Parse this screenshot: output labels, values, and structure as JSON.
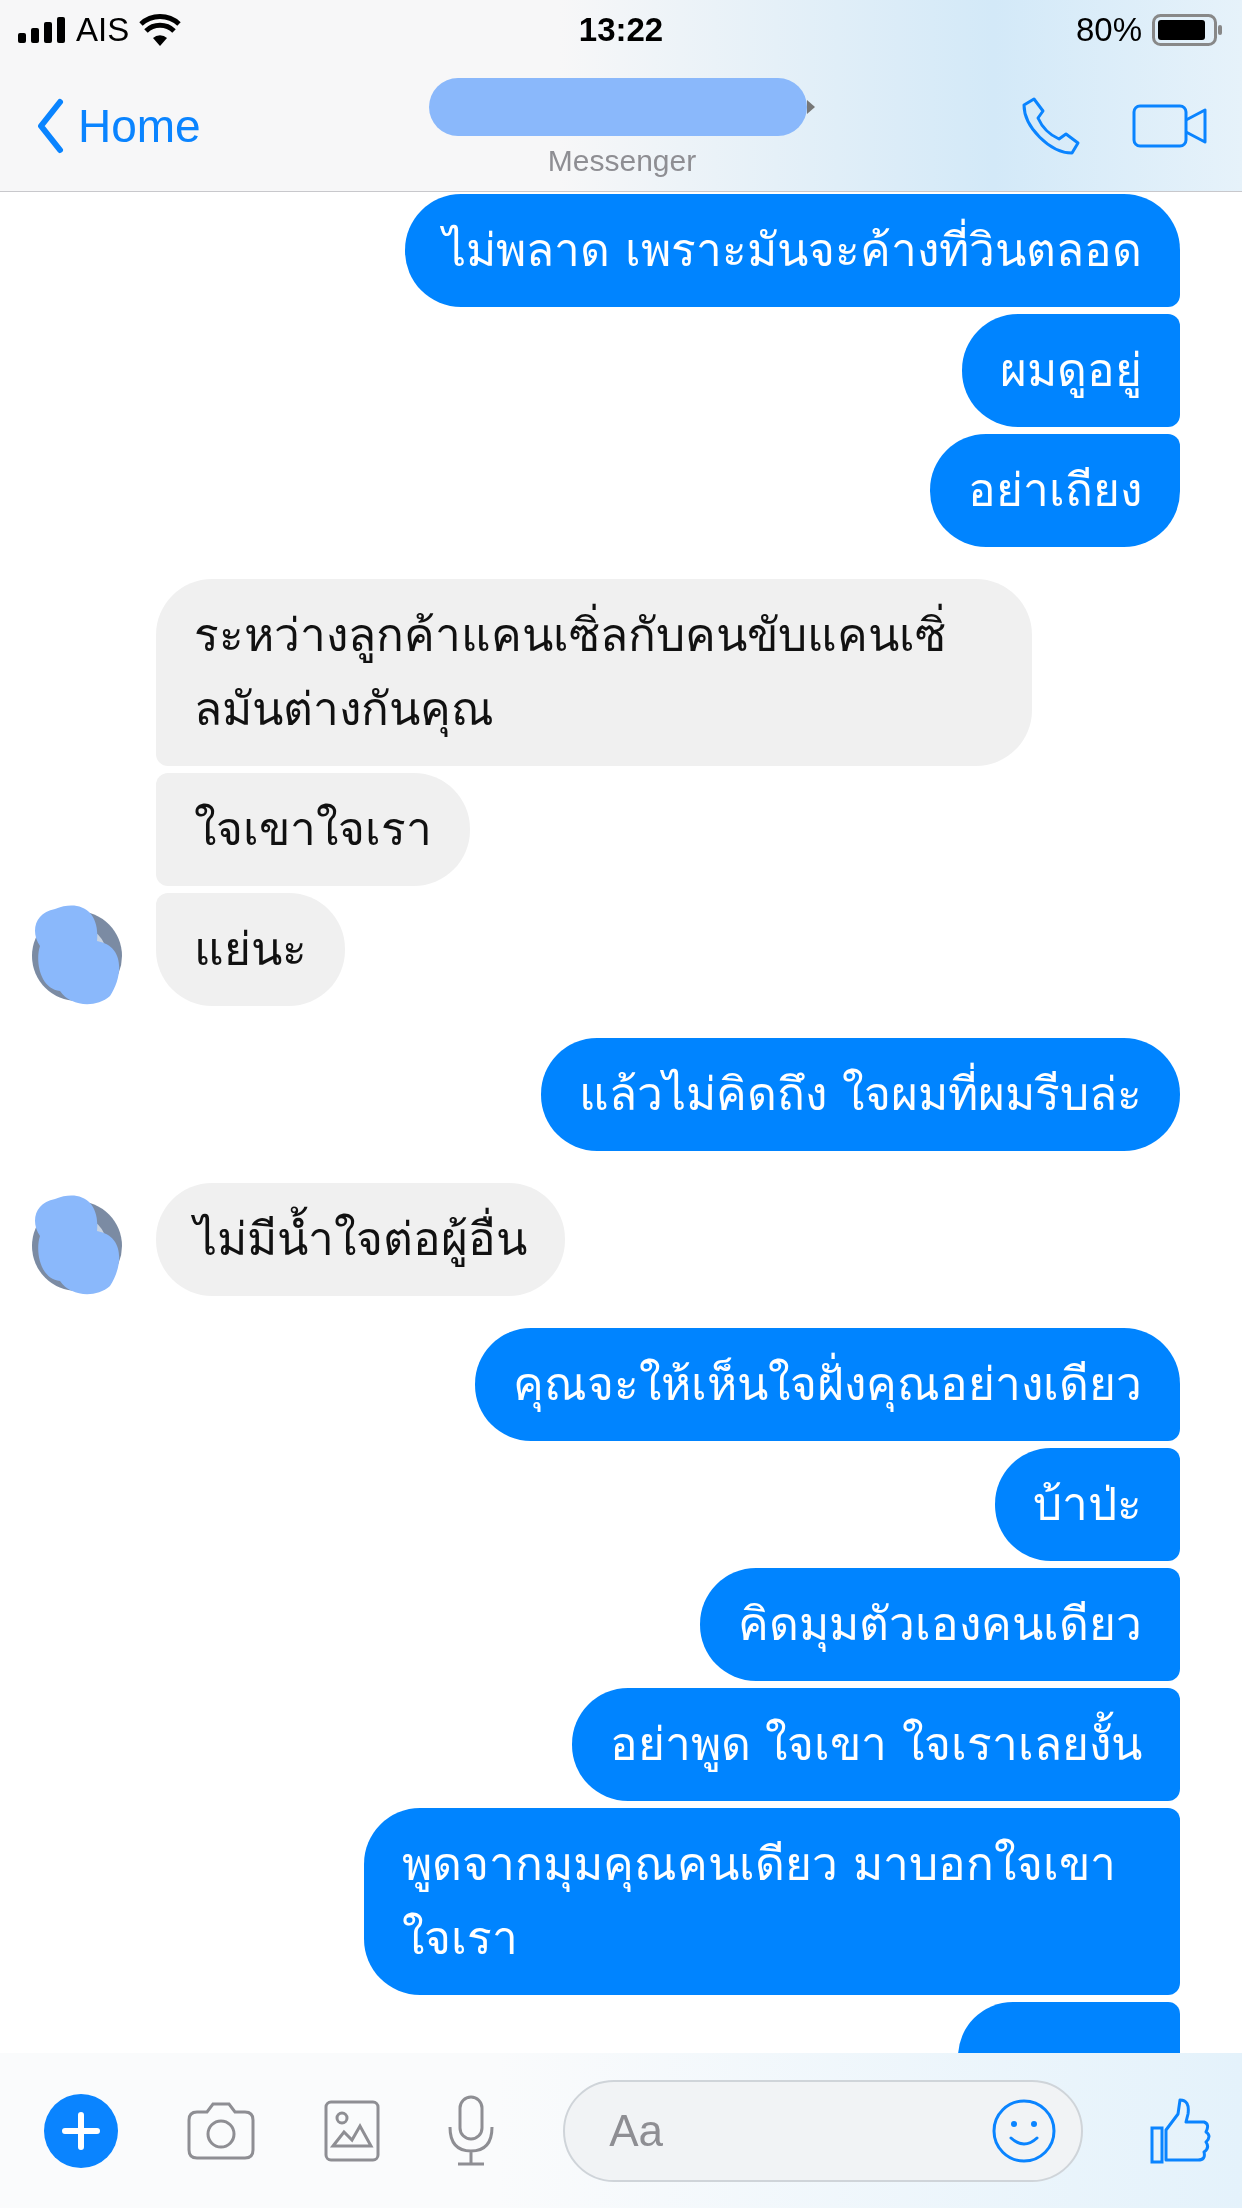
{
  "status_bar": {
    "carrier": "AIS",
    "time": "13:22",
    "battery": "80%"
  },
  "nav": {
    "back_label": "Home",
    "subtitle": "Messenger"
  },
  "groups": [
    {
      "kind": "sent",
      "bubbles": [
        {
          "text": "ไม่พลาด เพราะมันจะค้างที่วินตลอด"
        },
        {
          "text": "ผมดูอยู่"
        },
        {
          "text": "อย่าเถียง"
        }
      ]
    },
    {
      "kind": "received",
      "bubbles": [
        {
          "text": "ระหว่างลูกค้าแคนเซิ่ลกับคนขับแคนเซิ่ลมันต่างกันคุณ"
        },
        {
          "text": "ใจเขาใจเรา"
        },
        {
          "text": "แย่นะ"
        }
      ]
    },
    {
      "kind": "sent",
      "bubbles": [
        {
          "text": "แล้วไม่คิดถึง ใจผมที่ผมรีบล่ะ"
        }
      ]
    },
    {
      "kind": "received",
      "bubbles": [
        {
          "text": "ไม่มีน้ำใจต่อผู้อื่น"
        }
      ]
    },
    {
      "kind": "sent",
      "bubbles": [
        {
          "text": "คุณจะให้เห็นใจฝั่งคุณอย่างเดียว"
        },
        {
          "text": "บ้าป่ะ"
        },
        {
          "text": "คิดมุมตัวเองคนเดียว"
        },
        {
          "text": "อย่าพูด ใจเขา ใจเราเลยงั้น"
        },
        {
          "text": "พูดจากมุมคุณคนเดียว มาบอกใจเขาใจเรา"
        },
        {
          "kind": "clipped"
        }
      ]
    }
  ],
  "composer": {
    "placeholder": "Aa"
  }
}
